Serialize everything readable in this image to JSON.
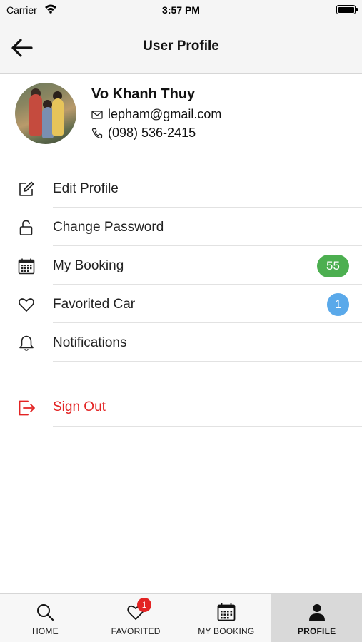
{
  "status_bar": {
    "carrier": "Carrier",
    "time": "3:57 PM"
  },
  "nav": {
    "title": "User Profile",
    "back_icon": "arrow-left-icon"
  },
  "profile": {
    "name": "Vo Khanh Thuy",
    "email": "lepham@gmail.com",
    "phone": "(098) 536-2415"
  },
  "menu": {
    "items": [
      {
        "label": "Edit Profile",
        "icon": "edit-icon"
      },
      {
        "label": "Change Password",
        "icon": "unlock-icon"
      },
      {
        "label": "My Booking",
        "icon": "calendar-icon",
        "badge": "55",
        "badge_color": "#4caf50"
      },
      {
        "label": "Favorited Car",
        "icon": "heart-icon",
        "badge": "1",
        "badge_color": "#5aa9ea"
      },
      {
        "label": "Notifications",
        "icon": "bell-icon"
      }
    ],
    "sign_out": {
      "label": "Sign Out",
      "icon": "sign-out-icon",
      "color": "#e32424"
    }
  },
  "tab_bar": {
    "tabs": [
      {
        "label": "HOME",
        "icon": "search-icon"
      },
      {
        "label": "FAVORITED",
        "icon": "heart-icon",
        "badge": "1"
      },
      {
        "label": "MY BOOKING",
        "icon": "calendar-icon"
      },
      {
        "label": "PROFILE",
        "icon": "person-icon",
        "active": true
      }
    ]
  }
}
